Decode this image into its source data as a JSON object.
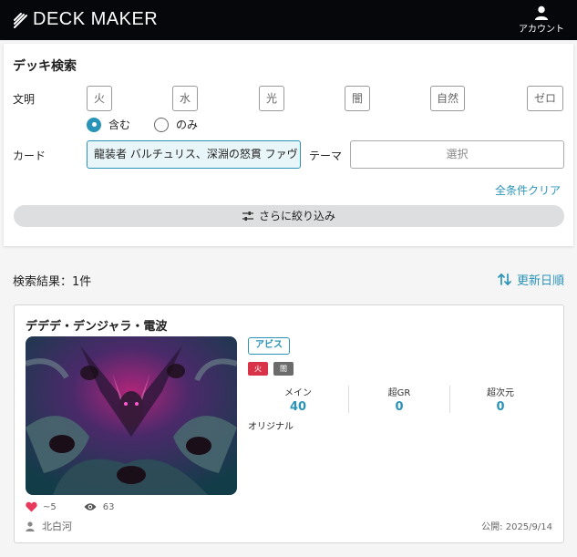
{
  "header": {
    "logo_text": "DECK MAKER",
    "account_label": "アカウント"
  },
  "search": {
    "title": "デッキ検索",
    "civ_label": "文明",
    "civilizations": [
      "火",
      "水",
      "光",
      "闇",
      "自然",
      "ゼロ"
    ],
    "mode_include": "含む",
    "mode_only": "のみ",
    "selected_mode": "含む",
    "card_label": "カード",
    "card_value": "龍装者 バルチュリス、深淵の怒貫 ファヴ",
    "theme_label": "テーマ",
    "theme_placeholder": "選択",
    "clear_label": "全条件クリア",
    "refine_label": "さらに絞り込み"
  },
  "results": {
    "count_label": "検索結果：1件",
    "sort_label": "更新日順"
  },
  "deck": {
    "title": "デデデ・デンジャラ・電波",
    "tag": "アビス",
    "civs": [
      {
        "label": "火",
        "color": "#d9334a"
      },
      {
        "label": "闇",
        "color": "#6b6b6b"
      }
    ],
    "stats": [
      {
        "label": "メイン",
        "value": "40"
      },
      {
        "label": "超GR",
        "value": "0"
      },
      {
        "label": "超次元",
        "value": "0"
      }
    ],
    "type": "オリジナル",
    "likes": "~5",
    "views": "63",
    "author": "北白河",
    "published": "公開: 2025/9/14"
  },
  "colors": {
    "accent": "#2a93b8",
    "header_bg": "#05070a",
    "like": "#e8385c"
  }
}
